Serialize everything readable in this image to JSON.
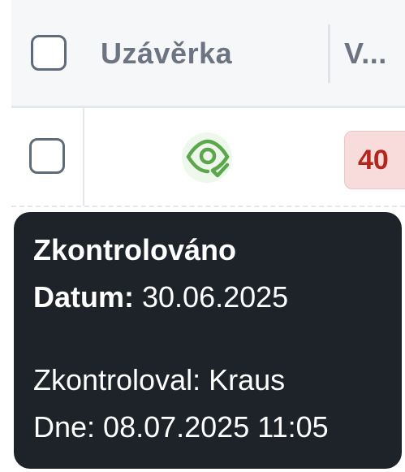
{
  "table": {
    "header": {
      "column_1_label": "Uzávěrka",
      "column_2_label": "V..."
    },
    "row": {
      "status_icon": "eye-check-icon",
      "badge_value": "40"
    }
  },
  "tooltip": {
    "title": "Zkontrolováno",
    "date_label": "Datum:",
    "date_value": "30.06.2025",
    "checked_by": "Zkontroloval: Kraus",
    "checked_at": "Dne: 08.07.2025 11:05"
  },
  "colors": {
    "status_green": "#5aa84a",
    "badge_bg": "#f8dcdc",
    "badge_text": "#b3261e",
    "tooltip_bg": "#1e2329"
  }
}
